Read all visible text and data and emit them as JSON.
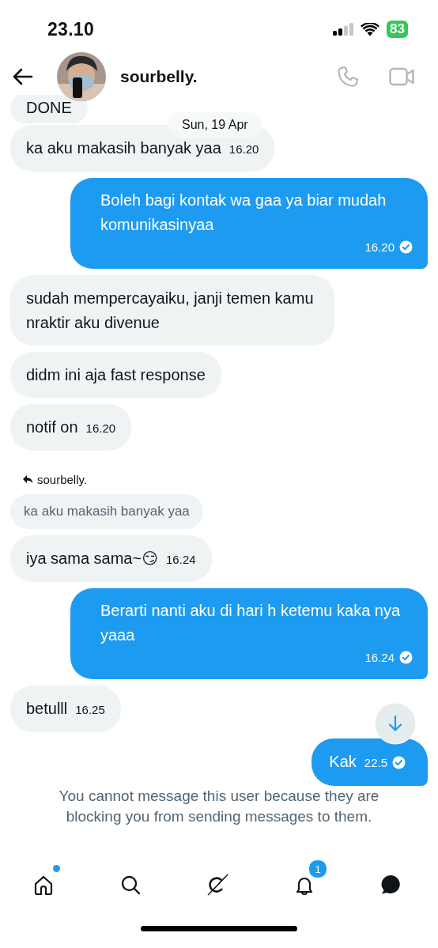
{
  "status_bar": {
    "time": "23.10",
    "battery": "83"
  },
  "header": {
    "name": "sourbelly."
  },
  "date_pill": "Sun, 19 Apr",
  "messages": [
    {
      "kind": "received",
      "text": "DONE"
    },
    {
      "kind": "received",
      "text": "ka aku makasih banyak yaa",
      "time": "16.20"
    },
    {
      "kind": "sent",
      "text": "Boleh bagi kontak wa gaa ya biar mudah komunikasinyaa",
      "time": "16.20",
      "read": true
    },
    {
      "kind": "received",
      "text": "sudah mempercayaiku, janji temen kamu nraktir aku divenue"
    },
    {
      "kind": "received",
      "text": "didm ini aja fast response"
    },
    {
      "kind": "received",
      "text": "notif on",
      "time": "16.20"
    },
    {
      "kind": "reply_label",
      "text": "sourbelly."
    },
    {
      "kind": "quoted",
      "text": "ka aku makasih banyak yaa"
    },
    {
      "kind": "received",
      "text": "iya sama sama~😏",
      "time": "16.24"
    },
    {
      "kind": "sent",
      "text": "Berarti nanti aku di hari h ketemu kaka nya yaaa",
      "time": "16.24",
      "read": true
    },
    {
      "kind": "received",
      "text": "betulll",
      "time": "16.25"
    },
    {
      "kind": "sent",
      "text": "Kak",
      "time": "22.5",
      "read": true
    }
  ],
  "notice": "You cannot message this user because they are blocking you from sending messages to them.",
  "nav": [
    {
      "kind": "home",
      "selected": false,
      "dot": true
    },
    {
      "kind": "search",
      "selected": false
    },
    {
      "kind": "grok",
      "selected": false
    },
    {
      "kind": "bell",
      "selected": false,
      "badge": "1"
    },
    {
      "kind": "messages",
      "selected": true
    }
  ]
}
